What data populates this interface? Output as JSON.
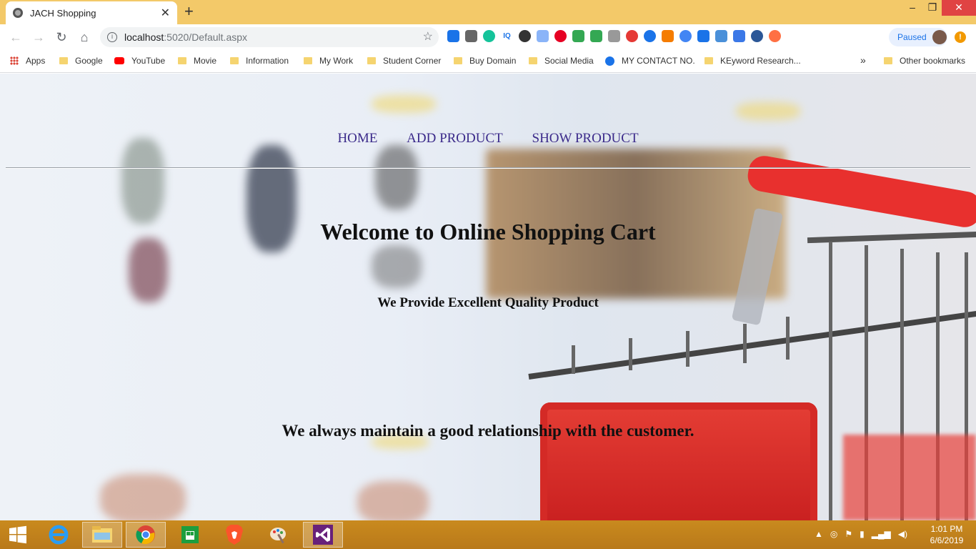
{
  "browser": {
    "tab_title": "JACH Shopping",
    "tab_close": "✕",
    "new_tab": "+",
    "window": {
      "minimize": "–",
      "restore": "❐",
      "close": "✕"
    },
    "nav": {
      "back": "←",
      "forward": "→",
      "reload": "↻",
      "home": "⌂"
    },
    "url_host": "localhost",
    "url_path": ":5020/Default.aspx",
    "profile_status": "Paused",
    "bookmarks": [
      {
        "label": "Apps",
        "icon": "apps-grid-icon"
      },
      {
        "label": "Google",
        "icon": "folder-icon"
      },
      {
        "label": "YouTube",
        "icon": "youtube-icon"
      },
      {
        "label": "Movie",
        "icon": "folder-icon"
      },
      {
        "label": "Information",
        "icon": "folder-icon"
      },
      {
        "label": "My Work",
        "icon": "folder-icon"
      },
      {
        "label": "Student Corner",
        "icon": "folder-icon"
      },
      {
        "label": "Buy Domain",
        "icon": "folder-icon"
      },
      {
        "label": "Social Media",
        "icon": "folder-icon"
      },
      {
        "label": "MY CONTACT NO.",
        "icon": "person-icon"
      },
      {
        "label": "KEyword Research...",
        "icon": "folder-icon"
      }
    ],
    "bookmarks_overflow": "»",
    "other_bookmarks": "Other bookmarks"
  },
  "page": {
    "nav": [
      "HOME",
      "ADD PRODUCT",
      "SHOW PRODUCT"
    ],
    "heading": "Welcome to Online Shopping Cart",
    "subheading": "We Provide Excellent Quality Product",
    "tagline": "We always maintain a good relationship with the customer."
  },
  "taskbar": {
    "time": "1:01 PM",
    "date": "6/6/2019"
  },
  "colors": {
    "title_bar": "#f3c969",
    "nav_link": "#3b2a8a",
    "taskbar": "#c98a1e"
  }
}
